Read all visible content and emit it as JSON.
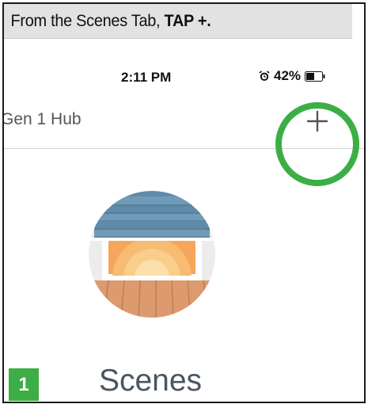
{
  "instruction": {
    "prefix": "From the Scenes Tab, ",
    "action": "TAP +."
  },
  "status_bar": {
    "time": "2:11 PM",
    "battery_text": "42%"
  },
  "header": {
    "hub_name": "Gen 1 Hub",
    "add_button_label": "+"
  },
  "main": {
    "title": "Scenes"
  },
  "step_badge": "1",
  "colors": {
    "highlight": "#3cae45",
    "badge": "#3cae45",
    "title": "#4a5561"
  }
}
